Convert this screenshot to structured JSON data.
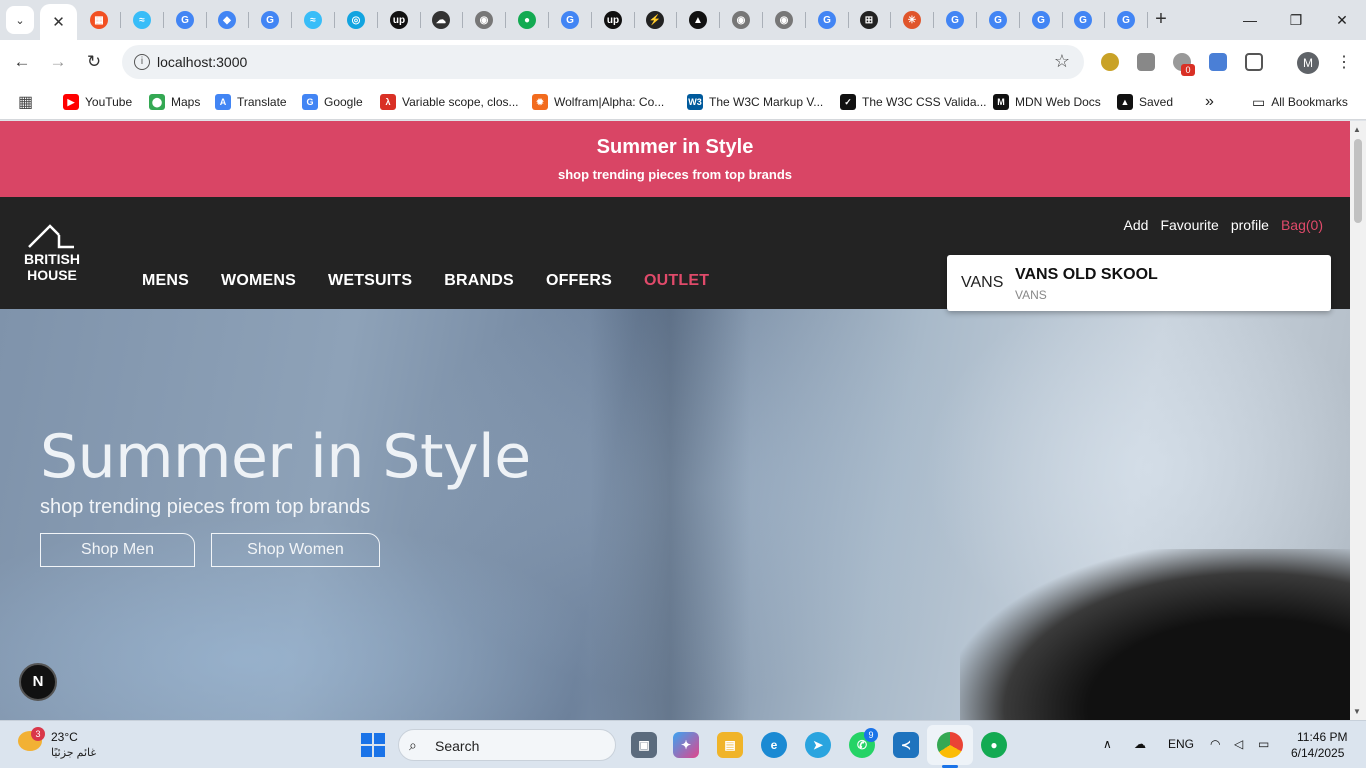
{
  "browser": {
    "address": "localhost:3000",
    "tab_close": "✕",
    "tab_search": "⌄",
    "new_tab": "+",
    "minimize": "—",
    "maximize": "❐",
    "close": "✕",
    "back": "←",
    "forward": "→",
    "reload": "↻",
    "profile_initial": "M",
    "extension_badge": "0",
    "tab_favicons": [
      {
        "icon": "microsoft-icon",
        "color": "#f25022",
        "glyph": "▦"
      },
      {
        "icon": "tailwind-icon",
        "color": "#38bdf8",
        "glyph": "≈"
      },
      {
        "icon": "google-icon",
        "color": "#4285f4",
        "glyph": "G"
      },
      {
        "icon": "diamond-icon",
        "color": "#4285f4",
        "glyph": "◆"
      },
      {
        "icon": "google-icon",
        "color": "#4285f4",
        "glyph": "G"
      },
      {
        "icon": "tailwind-icon",
        "color": "#38bdf8",
        "glyph": "≈"
      },
      {
        "icon": "circle-icon",
        "color": "#12a4e0",
        "glyph": "◎"
      },
      {
        "icon": "upwork-icon",
        "color": "#111111",
        "glyph": "up"
      },
      {
        "icon": "cloud-icon",
        "color": "#333333",
        "glyph": "☁"
      },
      {
        "icon": "chrome-icon",
        "color": "#777777",
        "glyph": "◉"
      },
      {
        "icon": "mongodb-icon",
        "color": "#13aa52",
        "glyph": "●"
      },
      {
        "icon": "google-icon",
        "color": "#4285f4",
        "glyph": "G"
      },
      {
        "icon": "upwork-icon",
        "color": "#111111",
        "glyph": "up"
      },
      {
        "icon": "vercel-icon",
        "color": "#222222",
        "glyph": "⚡"
      },
      {
        "icon": "triangle-icon",
        "color": "#111111",
        "glyph": "▲"
      },
      {
        "icon": "chrome-icon",
        "color": "#777777",
        "glyph": "◉"
      },
      {
        "icon": "chrome-icon",
        "color": "#777777",
        "glyph": "◉"
      },
      {
        "icon": "google-icon",
        "color": "#4285f4",
        "glyph": "G"
      },
      {
        "icon": "shield-icon",
        "color": "#222222",
        "glyph": "⊞"
      },
      {
        "icon": "asterisk-icon",
        "color": "#e0552b",
        "glyph": "✳"
      },
      {
        "icon": "google-icon",
        "color": "#4285f4",
        "glyph": "G"
      },
      {
        "icon": "google-icon",
        "color": "#4285f4",
        "glyph": "G"
      },
      {
        "icon": "google-icon",
        "color": "#4285f4",
        "glyph": "G"
      },
      {
        "icon": "google-icon",
        "color": "#4285f4",
        "glyph": "G"
      },
      {
        "icon": "google-icon",
        "color": "#4285f4",
        "glyph": "G"
      }
    ]
  },
  "bookmarks": {
    "items": [
      {
        "label": "YouTube",
        "icon": "youtube-icon",
        "color": "#ff0000",
        "glyph": "▶"
      },
      {
        "label": "Maps",
        "icon": "maps-icon",
        "color": "#34a853",
        "glyph": "⬤"
      },
      {
        "label": "Translate",
        "icon": "translate-icon",
        "color": "#4285f4",
        "glyph": "A"
      },
      {
        "label": "Google",
        "icon": "google-icon",
        "color": "#4285f4",
        "glyph": "G"
      },
      {
        "label": "Variable scope, clos...",
        "icon": "mdn-icon",
        "color": "#d93025",
        "glyph": "λ"
      },
      {
        "label": "Wolfram|Alpha: Co...",
        "icon": "wolfram-icon",
        "color": "#f26b1d",
        "glyph": "✹"
      },
      {
        "label": "The W3C Markup V...",
        "icon": "w3c-icon",
        "color": "#005a9c",
        "glyph": "W3"
      },
      {
        "label": "The W3C CSS Valida...",
        "icon": "css-icon",
        "color": "#111111",
        "glyph": "✓"
      },
      {
        "label": "MDN Web Docs",
        "icon": "mdn-icon",
        "color": "#111111",
        "glyph": "M"
      },
      {
        "label": "Saved",
        "icon": "saved-icon",
        "color": "#111111",
        "glyph": "▲"
      }
    ],
    "more": "»",
    "all_bookmarks": "All Bookmarks"
  },
  "promo": {
    "title": "Summer in Style",
    "subtitle": "shop trending pieces from top brands"
  },
  "header": {
    "logo_line1": "BRITISH",
    "logo_line2": "HOUSE",
    "nav": [
      "MENS",
      "WOMENS",
      "WETSUITS",
      "BRANDS",
      "OFFERS",
      "OUTLET"
    ],
    "util": {
      "add": "Add",
      "favourite": "Favourite",
      "profile": "profile",
      "bag": "Bag(0)"
    }
  },
  "search_result": {
    "image_alt": "VANS",
    "name": "VANS OLD SKOOL",
    "brand": "VANS"
  },
  "hero": {
    "title": "Summer in Style",
    "subtitle": "shop trending pieces from top brands",
    "btn_men": "Shop Men",
    "btn_women": "Shop Women"
  },
  "next_badge": "N",
  "taskbar": {
    "weather_temp": "23°C",
    "weather_desc": "غائم جزئيًا",
    "weather_badge": "3",
    "search_label": "Search",
    "whatsapp_badge": "9",
    "language": "ENG",
    "time": "11:46 PM",
    "date": "6/14/2025"
  },
  "colors": {
    "promo": "#d94565",
    "header": "#232323",
    "accent": "#e04a6a"
  }
}
